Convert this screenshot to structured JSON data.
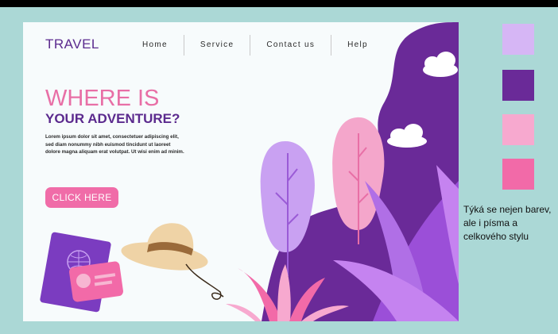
{
  "brand": {
    "logo": "TRAVEL"
  },
  "nav": {
    "items": [
      "Home",
      "Service",
      "Contact us",
      "Help"
    ]
  },
  "hero": {
    "title_line1": "WHERE IS",
    "title_line2": "YOUR ADVENTURE?",
    "body_line1": "Lorem ipsum dolor sit amet, consectetuer adipiscing elit,",
    "body_line2": "sed diam nonummy nibh euismod tincidunt ut laoreet",
    "body_line3": "dolore magna aliquam erat volutpat. Ut wisi enim ad minim.",
    "cta_label": "CLICK HERE"
  },
  "palette": {
    "swatches": [
      "#d6b6f5",
      "#6a2a98",
      "#f7a9cf",
      "#f26aa8"
    ]
  },
  "note": {
    "text": "Týká se nejen barev, ale i písma a celkového stylu"
  }
}
